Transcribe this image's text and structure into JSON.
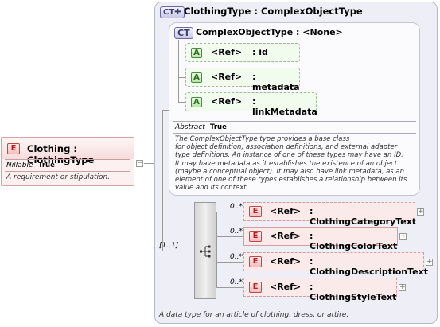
{
  "clothing_element": {
    "badge": "E",
    "title": "Clothing : ClothingType",
    "nillable_label": "Nillable",
    "nillable_value": "True",
    "description": "A requirement or stipulation."
  },
  "clothing_type": {
    "badge": "CT",
    "title": "ClothingType : ComplexObjectType",
    "description": "A data type for an article of clothing, dress, or attire."
  },
  "complex_object_type": {
    "badge": "CT",
    "title": "ComplexObjectType : <None>",
    "attributes": [
      {
        "badge": "A",
        "ref": "<Ref>",
        "name": ": id"
      },
      {
        "badge": "A",
        "ref": "<Ref>",
        "name": ": metadata"
      },
      {
        "badge": "A",
        "ref": "<Ref>",
        "name": ": linkMetadata"
      }
    ],
    "abstract_label": "Abstract",
    "abstract_value": "True",
    "description_lines": [
      "The ComplexObjectType type provides a base class",
      "for object definition, association definitions, and external adapter",
      "type definitions. An instance of one of these types may have an ID.",
      "It may have metadata as it establishes the existence of an object",
      "(maybe a conceptual object). It may also have link metadata, as an",
      "element of one of these types establishes a relationship between its",
      "value and its context."
    ]
  },
  "sequence": {
    "multiplicity": "[1..1]"
  },
  "elements": [
    {
      "badge": "E",
      "ref": "<Ref>",
      "name": ": ClothingCategoryText",
      "multiplicity": "0..*"
    },
    {
      "badge": "E",
      "ref": "<Ref>",
      "name": ": ClothingColorText",
      "multiplicity": "0..*"
    },
    {
      "badge": "E",
      "ref": "<Ref>",
      "name": ": ClothingDescriptionText",
      "multiplicity": "0..*"
    },
    {
      "badge": "E",
      "ref": "<Ref>",
      "name": ": ClothingStyleText",
      "multiplicity": "0..*"
    }
  ],
  "icons": {
    "expand": "plus-icon",
    "collapse": "minus-icon",
    "sequence": "sequence-icon",
    "ct_expand": "complex-type-expand-icon"
  }
}
